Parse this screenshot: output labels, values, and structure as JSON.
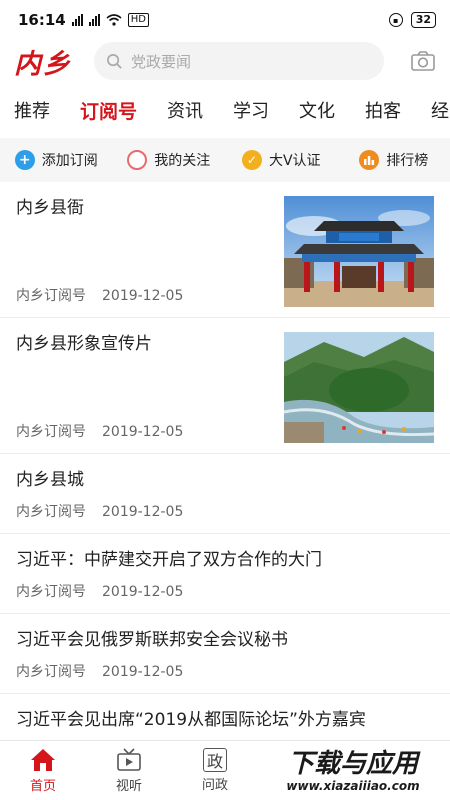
{
  "status_bar": {
    "time": "16:14",
    "network": "HD",
    "battery": "32"
  },
  "header": {
    "logo": "内乡",
    "search_placeholder": "党政要闻"
  },
  "tabs": [
    {
      "label": "推荐",
      "active": false
    },
    {
      "label": "订阅号",
      "active": true
    },
    {
      "label": "资讯",
      "active": false
    },
    {
      "label": "学习",
      "active": false
    },
    {
      "label": "文化",
      "active": false
    },
    {
      "label": "拍客",
      "active": false
    },
    {
      "label": "经济",
      "active": false
    }
  ],
  "actions": [
    {
      "label": "添加订阅",
      "icon": "plus-icon",
      "color": "#2e9ee8"
    },
    {
      "label": "我的关注",
      "icon": "circle-icon",
      "color": "#e86a6a"
    },
    {
      "label": "大V认证",
      "icon": "check-icon",
      "color": "#f2b01e"
    },
    {
      "label": "排行榜",
      "icon": "bar-chart-icon",
      "color": "#f08b1e"
    }
  ],
  "news": [
    {
      "title": "内乡县衙",
      "source": "内乡订阅号",
      "date": "2019-12-05",
      "image": "yamen-gate-photo"
    },
    {
      "title": "内乡县形象宣传片",
      "source": "内乡订阅号",
      "date": "2019-12-05",
      "image": "river-valley-photo"
    },
    {
      "title": "内乡县城",
      "source": "内乡订阅号",
      "date": "2019-12-05"
    },
    {
      "title": "习近平：中萨建交开启了双方合作的大门",
      "source": "内乡订阅号",
      "date": "2019-12-05"
    },
    {
      "title": "习近平会见俄罗斯联邦安全会议秘书",
      "source": "内乡订阅号",
      "date": "2019-12-05"
    },
    {
      "title": "习近平会见出席“2019从都国际论坛”外方嘉宾",
      "source": "",
      "date": ""
    }
  ],
  "bottom_nav": [
    {
      "label": "首页",
      "icon": "home-icon",
      "active": true
    },
    {
      "label": "视听",
      "icon": "tv-icon",
      "active": false
    },
    {
      "label": "问政",
      "icon": "zheng-icon",
      "glyph": "政",
      "active": false
    },
    {
      "label": "",
      "icon": "",
      "active": false
    },
    {
      "label": "",
      "icon": "",
      "active": false
    }
  ],
  "watermark": {
    "line1": "下载与应用",
    "line2": "www.xiazaiiiao.com"
  },
  "colors": {
    "accent": "#d4161c",
    "action_bg": "#f6f6f6"
  }
}
